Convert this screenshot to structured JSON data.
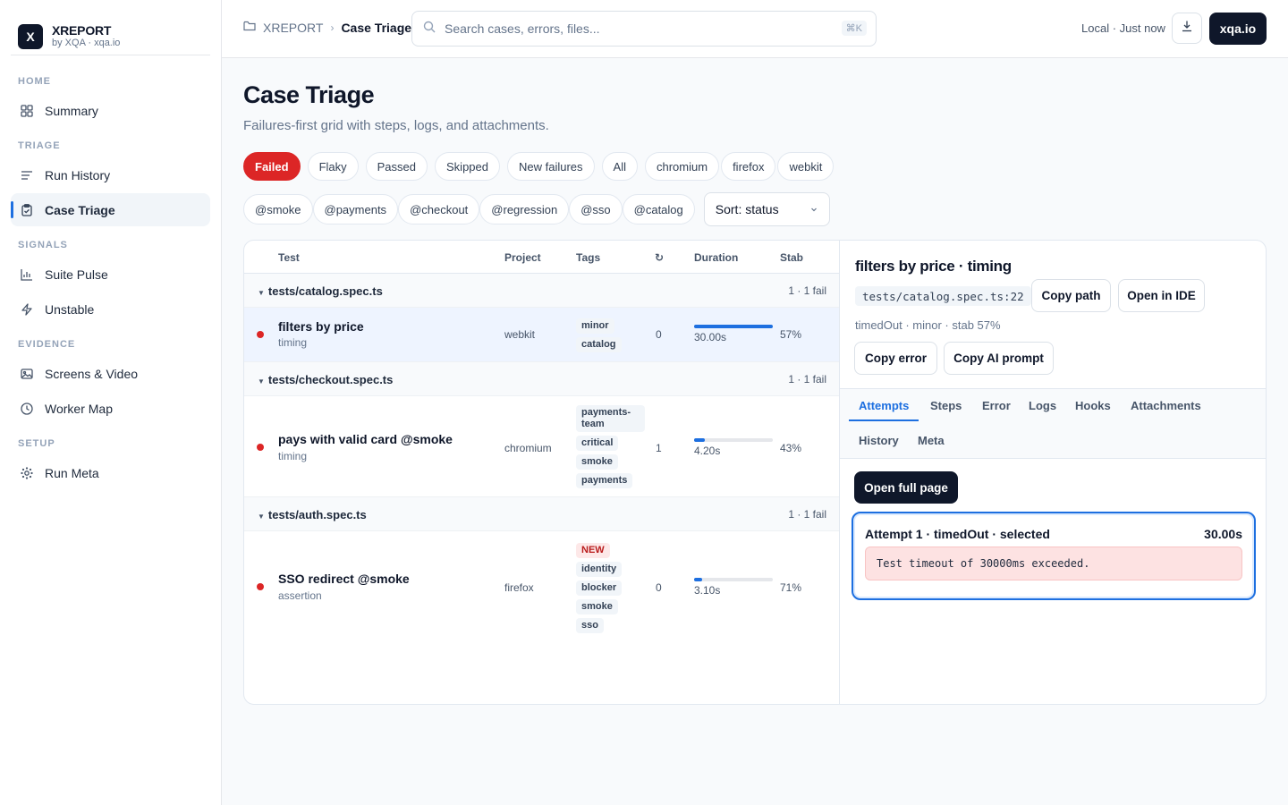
{
  "brand": {
    "logo": "X",
    "name": "XREPORT",
    "sub": "by XQA · xqa.io"
  },
  "sidebar": {
    "sections": [
      {
        "label": "HOME",
        "items": [
          {
            "label": "Summary",
            "icon": "grid-icon"
          }
        ]
      },
      {
        "label": "TRIAGE",
        "items": [
          {
            "label": "Run History",
            "icon": "list-icon"
          },
          {
            "label": "Case Triage",
            "icon": "clipboard-icon",
            "active": true
          }
        ]
      },
      {
        "label": "SIGNALS",
        "items": [
          {
            "label": "Suite Pulse",
            "icon": "bar-chart-icon"
          },
          {
            "label": "Unstable",
            "icon": "bolt-icon"
          }
        ]
      },
      {
        "label": "EVIDENCE",
        "items": [
          {
            "label": "Screens & Video",
            "icon": "image-icon"
          },
          {
            "label": "Worker Map",
            "icon": "clock-icon"
          }
        ]
      },
      {
        "label": "SETUP",
        "items": [
          {
            "label": "Run Meta",
            "icon": "sun-icon"
          }
        ]
      }
    ]
  },
  "topbar": {
    "breadcrumb_root": "XREPORT",
    "breadcrumb_sep": "›",
    "breadcrumb_current": "Case Triage",
    "search_placeholder": "Search cases, errors, files...",
    "search_shortcut": "⌘K",
    "status": "Local · Just now",
    "brand_button": "xqa.io"
  },
  "page": {
    "title": "Case Triage",
    "subtitle": "Failures-first grid with steps, logs, and attachments."
  },
  "filters": [
    "Failed",
    "Flaky",
    "Passed",
    "Skipped",
    "New failures",
    "All",
    "chromium",
    "firefox",
    "webkit"
  ],
  "tag_filters": [
    "@smoke",
    "@payments",
    "@checkout",
    "@regression",
    "@sso",
    "@catalog"
  ],
  "sort_label": "Sort: status",
  "table": {
    "columns": {
      "test": "Test",
      "project": "Project",
      "tags": "Tags",
      "retries": "↻",
      "duration": "Duration",
      "stab": "Stab"
    },
    "groups": [
      {
        "file": "tests/catalog.spec.ts",
        "count": "1 · 1 fail",
        "rows": [
          {
            "name": "filters by price",
            "sub": "timing",
            "project": "webkit",
            "tags": [
              "minor",
              "catalog"
            ],
            "retries": "0",
            "duration": "30.00s",
            "duration_fraction": 1.0,
            "stab": "57%"
          }
        ]
      },
      {
        "file": "tests/checkout.spec.ts",
        "count": "1 · 1 fail",
        "rows": [
          {
            "name": "pays with valid card @smoke",
            "sub": "timing",
            "project": "chromium",
            "tags": [
              "payments-team",
              "critical",
              "smoke",
              "payments"
            ],
            "retries": "1",
            "duration": "4.20s",
            "duration_fraction": 0.14,
            "stab": "43%"
          }
        ]
      },
      {
        "file": "tests/auth.spec.ts",
        "count": "1 · 1 fail",
        "rows": [
          {
            "name": "SSO redirect @smoke",
            "sub": "assertion",
            "project": "firefox",
            "tags": [
              "NEW",
              "identity",
              "blocker",
              "smoke",
              "sso"
            ],
            "retries": "0",
            "duration": "3.10s",
            "duration_fraction": 0.1,
            "stab": "71%"
          }
        ]
      }
    ]
  },
  "detail": {
    "title": "filters by price · timing",
    "path": "tests/catalog.spec.ts:22",
    "copy_path": "Copy path",
    "open_ide": "Open in IDE",
    "meta": "timedOut · minor · stab 57%",
    "copy_error": "Copy error",
    "copy_ai": "Copy AI prompt",
    "tabs": [
      "Attempts",
      "Steps",
      "Error",
      "Logs",
      "Hooks",
      "Attachments",
      "History",
      "Meta"
    ],
    "open_full": "Open full page",
    "attempt": {
      "title": "Attempt 1 · timedOut · selected",
      "duration": "30.00s",
      "error": "Test timeout of 30000ms exceeded."
    }
  },
  "colors": {
    "accent": "#1d6fe0",
    "failed": "#dc2626",
    "dark": "#0f172a"
  }
}
